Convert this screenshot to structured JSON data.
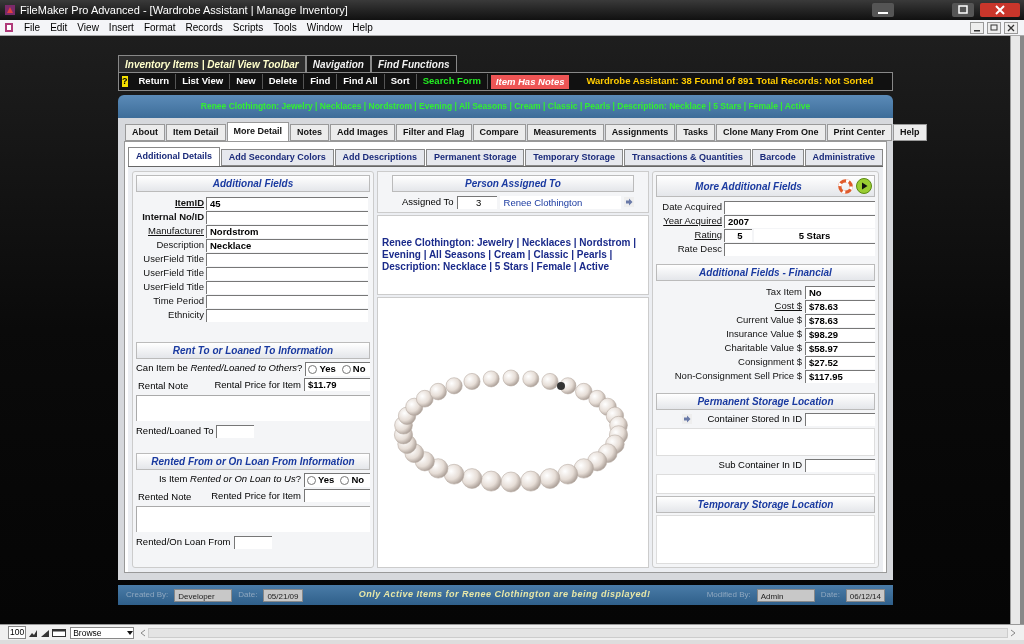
{
  "window": {
    "title": "FileMaker Pro Advanced - [Wardrobe Assistant | Manage Inventory]"
  },
  "menu": [
    "File",
    "Edit",
    "View",
    "Insert",
    "Format",
    "Records",
    "Scripts",
    "Tools",
    "Window",
    "Help"
  ],
  "toolbar": {
    "tabs": [
      {
        "label": "Inventory Items | Detail View Toolbar",
        "selected": true
      },
      {
        "label": "Navigation",
        "selected": false
      },
      {
        "label": "Find Functions",
        "selected": false
      }
    ],
    "help": "?",
    "buttons": [
      {
        "label": "Return",
        "kind": "plain"
      },
      {
        "label": "List View",
        "kind": "plain"
      },
      {
        "label": "New",
        "kind": "plain"
      },
      {
        "label": "Delete",
        "kind": "plain"
      },
      {
        "label": "Find",
        "kind": "plain"
      },
      {
        "label": "Find All",
        "kind": "plain"
      },
      {
        "label": "Sort",
        "kind": "plain"
      },
      {
        "label": "Search Form",
        "kind": "green"
      },
      {
        "label": "Item Has Notes",
        "kind": "alert"
      }
    ],
    "status": "Wardrobe Assistant:  38 Found of 891 Total Records: Not Sorted"
  },
  "summary": "Renee Clothington: Jewelry | Necklaces | Nordstrom | Evening | All Seasons | Cream | Classic | Pearls | Description: Necklace | 5 Stars | Female | Active",
  "main_tabs": [
    {
      "label": "About",
      "selected": false
    },
    {
      "label": "Item Detail",
      "selected": false
    },
    {
      "label": "More Detail",
      "selected": true
    },
    {
      "label": "Notes",
      "selected": false
    },
    {
      "label": "Add Images",
      "selected": false
    },
    {
      "label": "Filter and Flag",
      "selected": false
    },
    {
      "label": "Compare",
      "selected": false
    },
    {
      "label": "Measurements",
      "selected": false
    },
    {
      "label": "Assignments",
      "selected": false
    },
    {
      "label": "Tasks",
      "selected": false
    },
    {
      "label": "Clone Many From One",
      "selected": false
    },
    {
      "label": "Print Center",
      "selected": false
    },
    {
      "label": "Help",
      "selected": false
    }
  ],
  "sub_tabs": [
    {
      "label": "Additional Details",
      "selected": true
    },
    {
      "label": "Add Secondary Colors",
      "selected": false
    },
    {
      "label": "Add Descriptions",
      "selected": false
    },
    {
      "label": "Permanent Storage",
      "selected": false
    },
    {
      "label": "Temporary Storage",
      "selected": false
    },
    {
      "label": "Transactions & Quantities",
      "selected": false
    },
    {
      "label": "Barcode",
      "selected": false
    },
    {
      "label": "Administrative",
      "selected": false
    }
  ],
  "additional_fields": {
    "title": "Additional Fields",
    "fields": [
      {
        "label": "ItemID",
        "value": "45",
        "link": true,
        "bold": true
      },
      {
        "label": "Internal No/ID",
        "link": false,
        "bold": true
      },
      {
        "label": "Manufacturer",
        "value": "Nordstrom",
        "link": true,
        "bold": false
      },
      {
        "label": "Description",
        "value": "Necklace",
        "link": false,
        "bold": false
      },
      {
        "label": "UserField Title",
        "link": false,
        "bold": false
      },
      {
        "label": "UserField Title",
        "link": false,
        "bold": false
      },
      {
        "label": "UserField Title",
        "link": false,
        "bold": false
      },
      {
        "label": "Time Period",
        "link": false,
        "bold": false
      },
      {
        "label": "Ethnicity",
        "link": false,
        "bold": false
      }
    ]
  },
  "rent_to": {
    "title": "Rent To or Loaned To Information",
    "question": "Can Item be *Rented/Loaned to Others*?",
    "options": [
      {
        "label": "Yes",
        "selected": false
      },
      {
        "label": "No",
        "selected": false
      }
    ],
    "price_label": "Rental Price for Item",
    "price_value": "$11.79",
    "note_label": "Rental Note",
    "party_label": "Rented/Loaned To"
  },
  "rent_from": {
    "title": "Rented From or On Loan From Information",
    "question": "Is Item *Rented or On Loan to Us*?",
    "options": [
      {
        "label": "Yes",
        "selected": false
      },
      {
        "label": "No",
        "selected": false
      }
    ],
    "price_label": "Rented Price for Item",
    "note_label": "Rented Note",
    "party_label": "Rented/On Loan From"
  },
  "person": {
    "title": "Person Assigned To",
    "label": "Assigned To",
    "id": "3",
    "name": "Renee Clothington",
    "description": "Renee Clothington: Jewelry | Necklaces | Nordstrom | Evening | All Seasons | Cream | Classic | Pearls | Description: Necklace | 5 Stars | Female | Active"
  },
  "more_fields": {
    "title": "More Additional Fields",
    "fields": [
      {
        "label": "Date Acquired",
        "link": false
      },
      {
        "label": "Year Acquired",
        "value": "2007",
        "link": true
      },
      {
        "label": "Rating",
        "value": "5",
        "extra": "5 Stars",
        "link": true
      },
      {
        "label": "Rate Desc",
        "link": false
      }
    ]
  },
  "financial": {
    "title": "Additional Fields - Financial",
    "fields": [
      {
        "label": "Tax Item",
        "value": "No",
        "link": false
      },
      {
        "label": "Cost $",
        "value": "$78.63",
        "link": true
      },
      {
        "label": "Current Value $",
        "value": "$78.63",
        "link": false
      },
      {
        "label": "Insurance Value $",
        "value": "$98.29",
        "link": false
      },
      {
        "label": "Charitable Value $",
        "value": "$58.97",
        "link": false
      },
      {
        "label": "Consignment $",
        "value": "$27.52",
        "link": false
      },
      {
        "label": "Non-Consignment Sell Price $",
        "value": "$117.95",
        "link": false
      }
    ]
  },
  "permanent_storage": {
    "title": "Permanent Storage Location",
    "container_label": "Container Stored In ID",
    "sub_label": "Sub Container In ID"
  },
  "temporary_storage": {
    "title": "Temporary Storage Location"
  },
  "footer": {
    "created_label": "Created By:",
    "created_by": "Developer",
    "created_date_label": "Date:",
    "created_date": "05/21/09",
    "message": "Only Active Items for Renee Clothington are being displayed!",
    "modified_label": "Modified By:",
    "modified_by": "Admin",
    "modified_date_label": "Date:",
    "modified_date": "06/12/14"
  },
  "status_bar": {
    "zoom": "100",
    "mode": "Browse"
  }
}
